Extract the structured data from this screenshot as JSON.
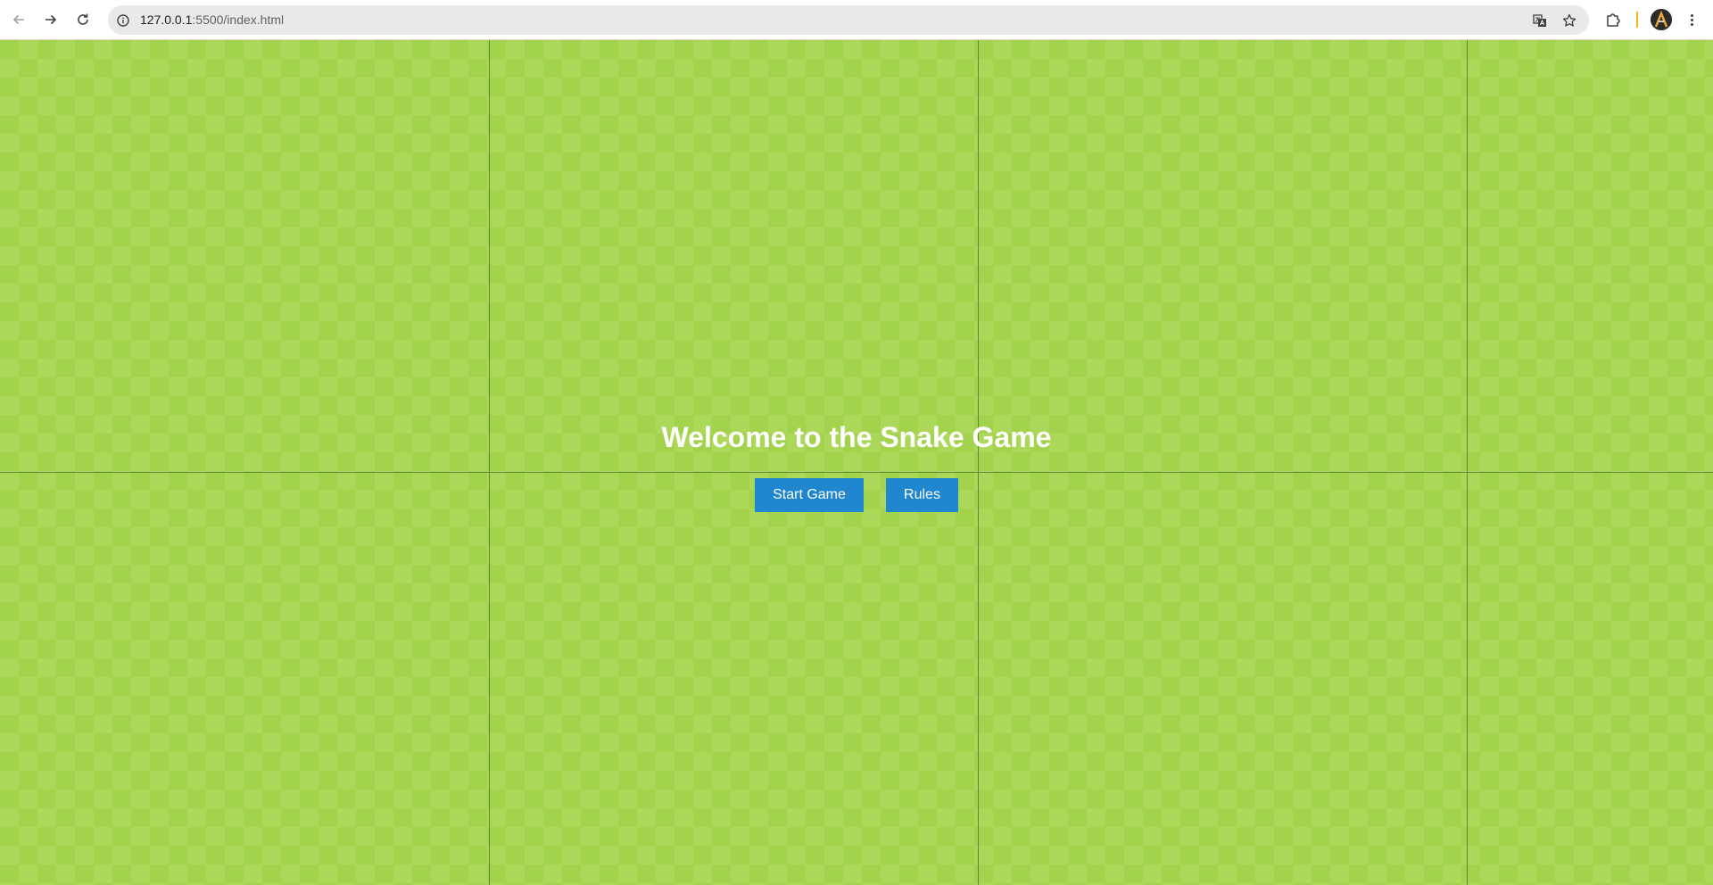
{
  "browser": {
    "url_host": "127.0.0.1",
    "url_path": ":5500/index.html",
    "icons": {
      "back": "arrow-left-icon",
      "forward": "arrow-right-icon",
      "reload": "reload-icon",
      "site_info": "info-icon",
      "translate": "translate-icon",
      "bookmark": "star-icon",
      "extensions": "puzzle-icon",
      "menu": "kebab-menu-icon"
    }
  },
  "game": {
    "title": "Welcome to the Snake Game",
    "buttons": {
      "start": "Start Game",
      "rules": "Rules"
    },
    "colors": {
      "field_light": "#acd859",
      "field_dark": "#a3d34d",
      "grid_line": "#5e8a37",
      "button": "#1f86cf",
      "title": "#ffffff"
    }
  }
}
